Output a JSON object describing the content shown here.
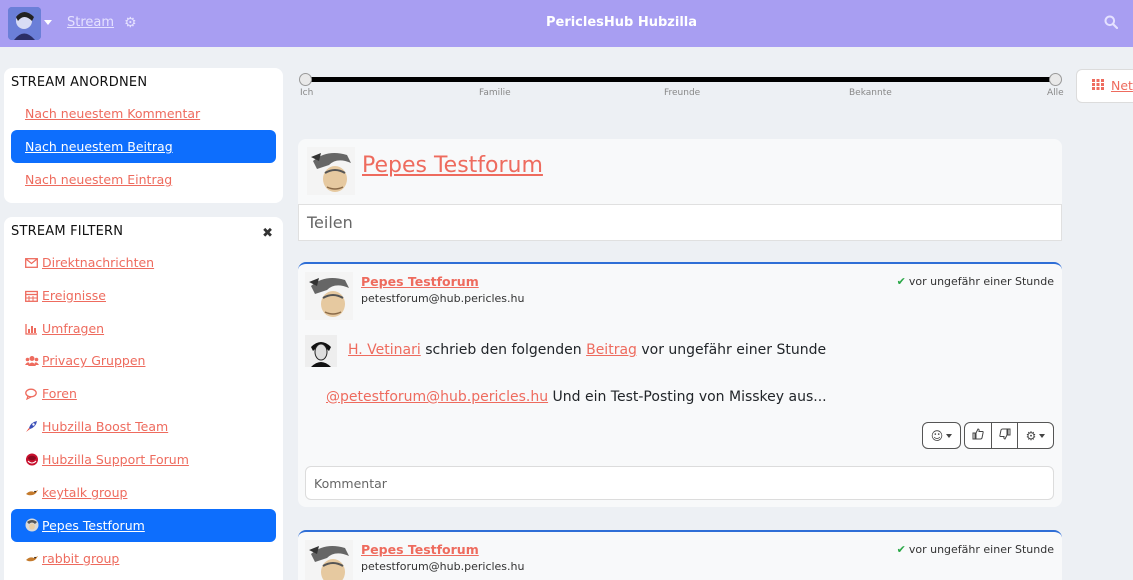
{
  "navbar": {
    "stream_label": "Stream",
    "site_title": "PericlesHub Hubzilla",
    "bg_color": "#a89ef2"
  },
  "order_panel": {
    "title": "STREAM ANORDNEN",
    "items": [
      {
        "label": "Nach neuestem Kommentar",
        "active": false
      },
      {
        "label": "Nach neuestem Beitrag",
        "active": true
      },
      {
        "label": "Nach neuestem Eintrag",
        "active": false
      }
    ]
  },
  "filter_panel": {
    "title": "STREAM FILTERN",
    "items": [
      {
        "label": "Direktnachrichten",
        "icon": "envelope-icon"
      },
      {
        "label": "Ereignisse",
        "icon": "calendar-icon"
      },
      {
        "label": "Umfragen",
        "icon": "bar-chart-icon"
      },
      {
        "label": "Privacy Gruppen ",
        "icon": "users-icon"
      },
      {
        "label": "Foren ",
        "icon": "comments-icon"
      },
      {
        "label": "Hubzilla Boost Team",
        "icon": "rocket-icon"
      },
      {
        "label": "Hubzilla Support Forum",
        "icon": "support-forum-icon"
      },
      {
        "label": "keytalk group",
        "icon": "bird-icon"
      },
      {
        "label": "Pepes Testforum",
        "icon": "forum-avatar-icon",
        "active": true
      },
      {
        "label": "rabbit group",
        "icon": "bird-icon"
      }
    ]
  },
  "slider": {
    "labels": [
      "Ich",
      "Familie",
      "Freunde",
      "Bekannte",
      "Alle"
    ],
    "range": [
      "Ich",
      "Alle"
    ]
  },
  "net_button": {
    "label": "Net"
  },
  "forum_header": {
    "name": "Pepes Testforum",
    "share_placeholder": "Teilen"
  },
  "posts": [
    {
      "author": "Pepes Testforum",
      "address": "petestforum@hub.pericles.hu",
      "time": "vor ungefähr einer Stunde",
      "share": {
        "name": "H. Vetinari",
        "text_mid": " schrieb den folgenden ",
        "link": "Beitrag",
        "text_end": " vor ungefähr einer Stunde"
      },
      "mention": "@petestforum@hub.pericles.hu",
      "body": " Und ein Test-Posting von Misskey aus...",
      "comment_placeholder": "Kommentar"
    },
    {
      "author": "Pepes Testforum",
      "address": "petestforum@hub.pericles.hu",
      "time": "vor ungefähr einer Stunde"
    }
  ],
  "colors": {
    "accent": "#ee6b5e",
    "active": "#0d6efd",
    "verified": "#28a745"
  }
}
